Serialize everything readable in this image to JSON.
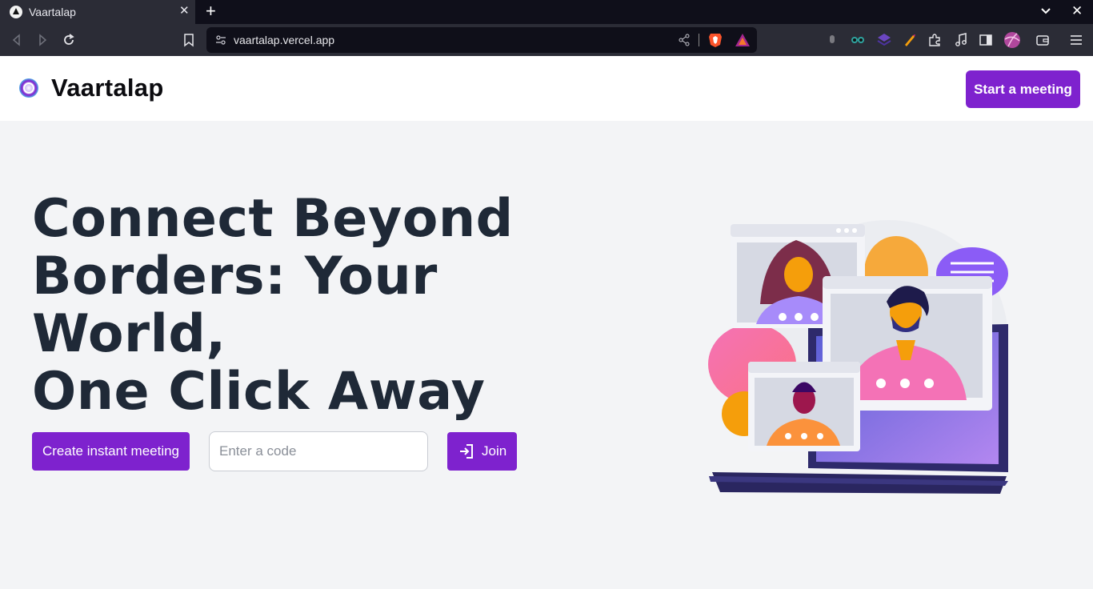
{
  "browser": {
    "tab_title": "Vaartalap",
    "url": "vaartalap.vercel.app",
    "extension_badge": "8"
  },
  "header": {
    "brand": "Vaartalap",
    "start_button": "Start a meeting"
  },
  "hero": {
    "title_lines": [
      "Connect Beyond",
      "Borders: Your World,",
      "One Click Away"
    ]
  },
  "actions": {
    "instant_button": "Create instant meeting",
    "code_placeholder": "Enter a code",
    "join_button": "Join"
  },
  "colors": {
    "accent": "#7e22ce",
    "page_bg": "#f3f4f6",
    "headline": "#1f2937"
  },
  "icons": [
    "back-icon",
    "forward-icon",
    "reload-icon",
    "bookmark-icon",
    "site-info-icon",
    "share-icon",
    "brave-shield-icon",
    "brave-rewards-icon",
    "extensions-icon",
    "media-icon",
    "sidebar-icon",
    "wallet-icon",
    "menu-icon"
  ]
}
